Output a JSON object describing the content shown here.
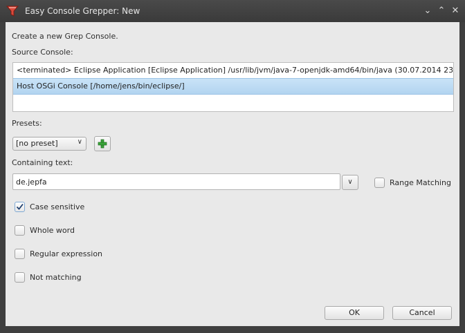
{
  "window": {
    "title": "Easy Console Grepper: New",
    "icon": "funnel-icon",
    "controls": [
      "minimize",
      "maximize",
      "close"
    ]
  },
  "dialog": {
    "description": "Create a new Grep Console.",
    "source_console_label": "Source Console:",
    "source_consoles": [
      {
        "label": "<terminated> Eclipse Application [Eclipse Application] /usr/lib/jvm/java-7-openjdk-amd64/bin/java (30.07.2014 23",
        "selected": false
      },
      {
        "label": "Host OSGi Console [/home/jens/bin/eclipse/]",
        "selected": true
      }
    ],
    "presets_label": "Presets:",
    "preset_selected": "[no preset]",
    "containing_text_label": "Containing text:",
    "containing_text_value": "de.jepfa",
    "range_matching_label": "Range Matching",
    "range_matching_checked": false,
    "options": [
      {
        "label": "Case sensitive",
        "checked": true
      },
      {
        "label": "Whole word",
        "checked": false
      },
      {
        "label": "Regular expression",
        "checked": false
      },
      {
        "label": "Not matching",
        "checked": false
      }
    ],
    "ok_label": "OK",
    "cancel_label": "Cancel"
  },
  "colors": {
    "titlebar": "#3f3f3f",
    "dialog_bg": "#e9e9e9",
    "selection": "#b8d8f2",
    "accent_icon": "#c0392b",
    "add_icon": "#3aa33a"
  }
}
